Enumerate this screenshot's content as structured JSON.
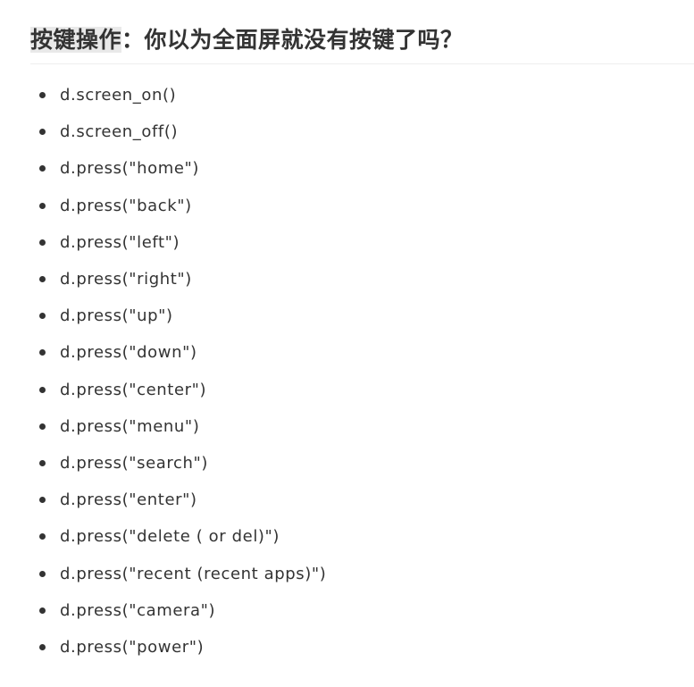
{
  "heading": {
    "highlighted": "按键操作",
    "rest": "：你以为全面屏就没有按键了吗？"
  },
  "items": [
    "d.screen_on()",
    "d.screen_off()",
    "d.press(\"home\")",
    "d.press(\"back\")",
    "d.press(\"left\")",
    "d.press(\"right\")",
    "d.press(\"up\")",
    "d.press(\"down\")",
    "d.press(\"center\")",
    "d.press(\"menu\")",
    "d.press(\"search\")",
    "d.press(\"enter\")",
    "d.press(\"delete ( or del)\")",
    "d.press(\"recent (recent apps)\")",
    "d.press(\"camera\")",
    "d.press(\"power\")"
  ]
}
